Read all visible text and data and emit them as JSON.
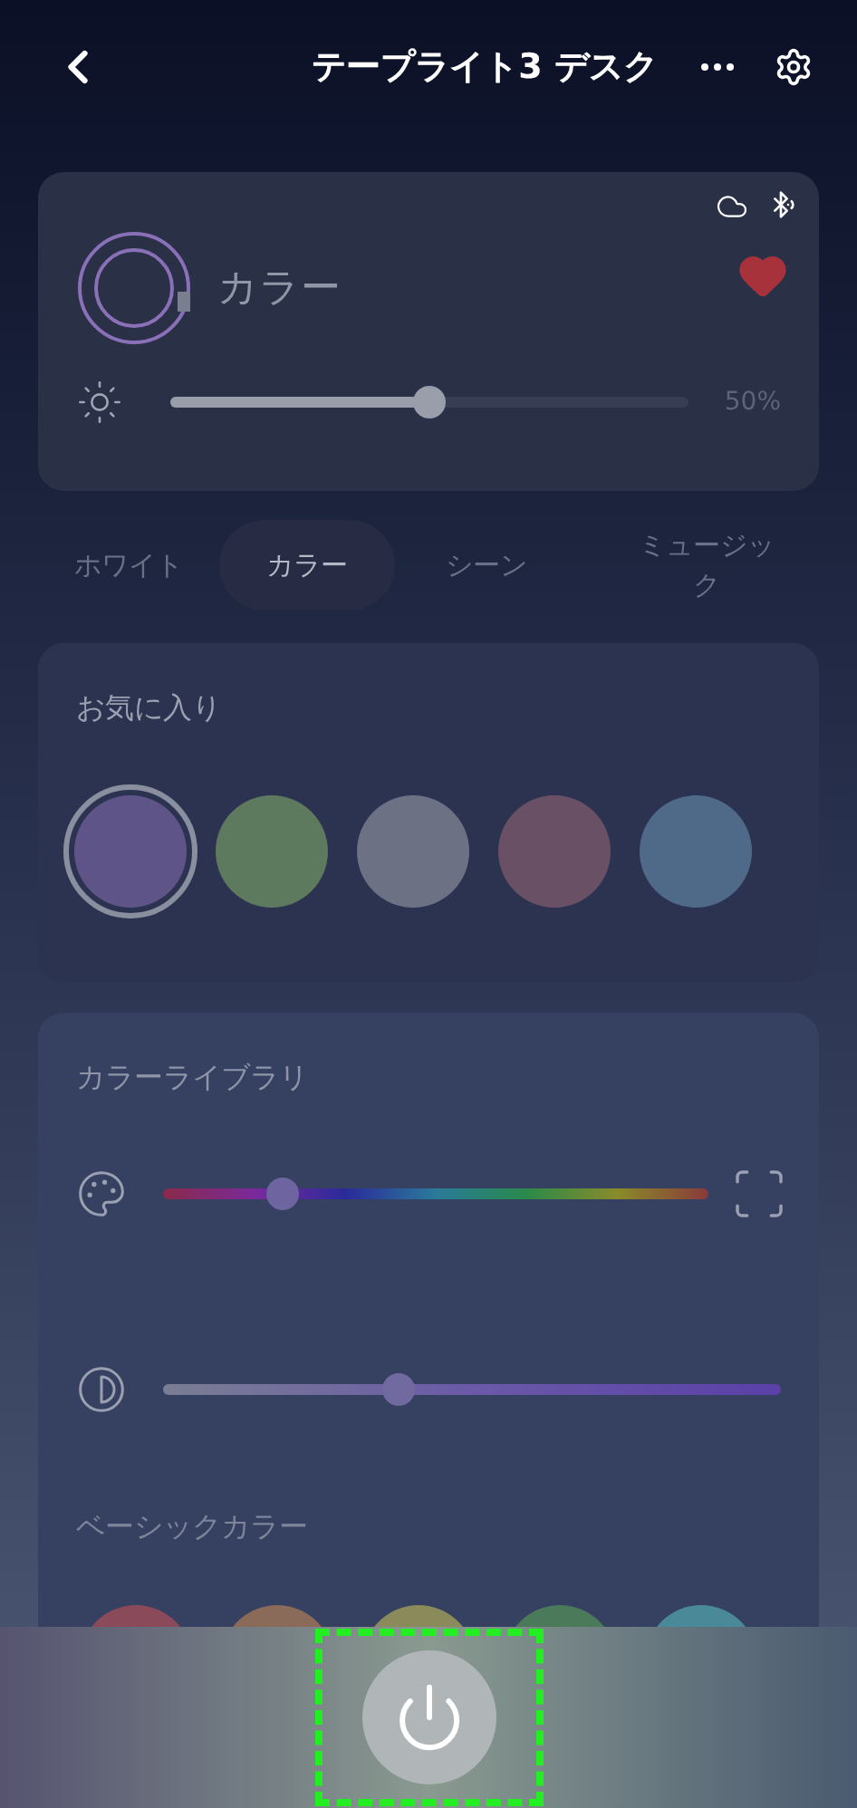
{
  "header": {
    "title": "テープライト3 デスク"
  },
  "device": {
    "mode": "カラー",
    "favorite": true,
    "brightness": {
      "level": 0.5,
      "reading": "50%"
    }
  },
  "tabs": [
    {
      "label": "ホワイト",
      "selected": false
    },
    {
      "label": "カラー",
      "selected": true
    },
    {
      "label": "シーン",
      "selected": false
    },
    {
      "label": "ミュージック",
      "selected": false
    }
  ],
  "favorites": {
    "title": "お気に入り",
    "colors": [
      {
        "color": "#5e5488",
        "selected": true
      },
      {
        "color": "#5e7a5e",
        "selected": false
      },
      {
        "color": "#6c7184",
        "selected": false
      },
      {
        "color": "#6a5064",
        "selected": false
      },
      {
        "color": "#4e6a88",
        "selected": false
      }
    ]
  },
  "library": {
    "title": "カラーライブラリ",
    "hue": {
      "level": 0.22
    },
    "saturation": {
      "level": 0.38
    }
  },
  "basic": {
    "title": "ベーシックカラー",
    "colors": [
      {
        "color": "#8a4a5a"
      },
      {
        "color": "#8a6a58"
      },
      {
        "color": "#8a8a5a"
      },
      {
        "color": "#4a7a5a"
      },
      {
        "color": "#4a8a98"
      }
    ]
  }
}
